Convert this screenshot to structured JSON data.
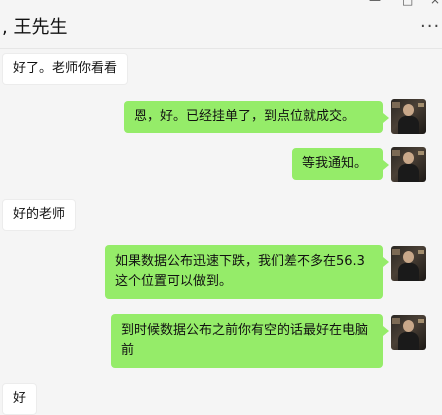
{
  "window": {
    "pin_icon": "pin-icon",
    "minimize_icon": "minimize-icon",
    "maximize_icon": "maximize-icon",
    "close_icon": "close-icon"
  },
  "header": {
    "title": ", 王先生",
    "more_label": "···"
  },
  "messages": [
    {
      "side": "left",
      "text": "好了。老师你看看"
    },
    {
      "side": "right",
      "text": "恩，好。已经挂单了，到点位就成交。"
    },
    {
      "side": "right",
      "text": "等我通知。"
    },
    {
      "side": "left",
      "text": "好的老师"
    },
    {
      "side": "right",
      "text": "如果数据公布迅速下跌，我们差不多在56.3这个位置可以做到。"
    },
    {
      "side": "right",
      "text": "到时候数据公布之前你有空的话最好在电脑前"
    },
    {
      "side": "left",
      "text": "好"
    }
  ],
  "colors": {
    "self_bubble": "#95ec69",
    "other_bubble": "#ffffff",
    "background": "#f5f5f5"
  }
}
